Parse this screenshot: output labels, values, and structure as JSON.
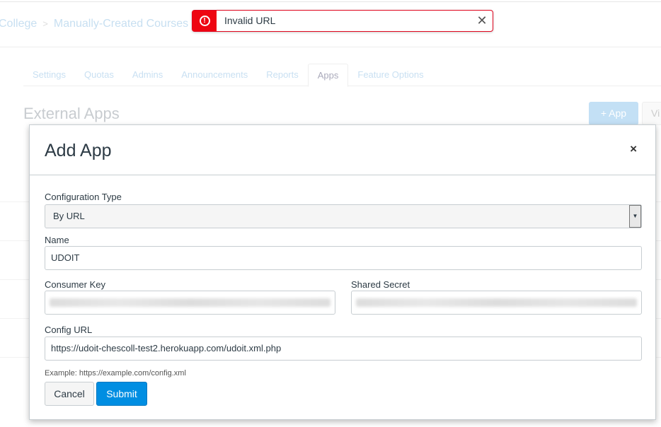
{
  "breadcrumb": [
    "College",
    "Manually-Created Courses"
  ],
  "tabs": [
    "Settings",
    "Quotas",
    "Admins",
    "Announcements",
    "Reports",
    "Apps",
    "Feature Options"
  ],
  "active_tab": "Apps",
  "page_title": "External Apps",
  "add_app_button": "+ App",
  "view_button": "Vi",
  "toast": {
    "message": "Invalid URL",
    "icon": "error-icon",
    "close": "✕",
    "color": "#ee0612"
  },
  "modal": {
    "title": "Add App",
    "close": "×",
    "configuration_type": {
      "label": "Configuration Type",
      "value": "By URL"
    },
    "name": {
      "label": "Name",
      "value": "UDOIT"
    },
    "consumer_key": {
      "label": "Consumer Key"
    },
    "shared_secret": {
      "label": "Shared Secret"
    },
    "config_url": {
      "label": "Config URL",
      "value": "https://udoit-chescoll-test2.herokuapp.com/udoit.xml.php",
      "hint": "Example: https://example.com/config.xml"
    },
    "cancel": "Cancel",
    "submit": "Submit"
  },
  "colors": {
    "primary": "#008ee2",
    "error": "#ee0612"
  }
}
